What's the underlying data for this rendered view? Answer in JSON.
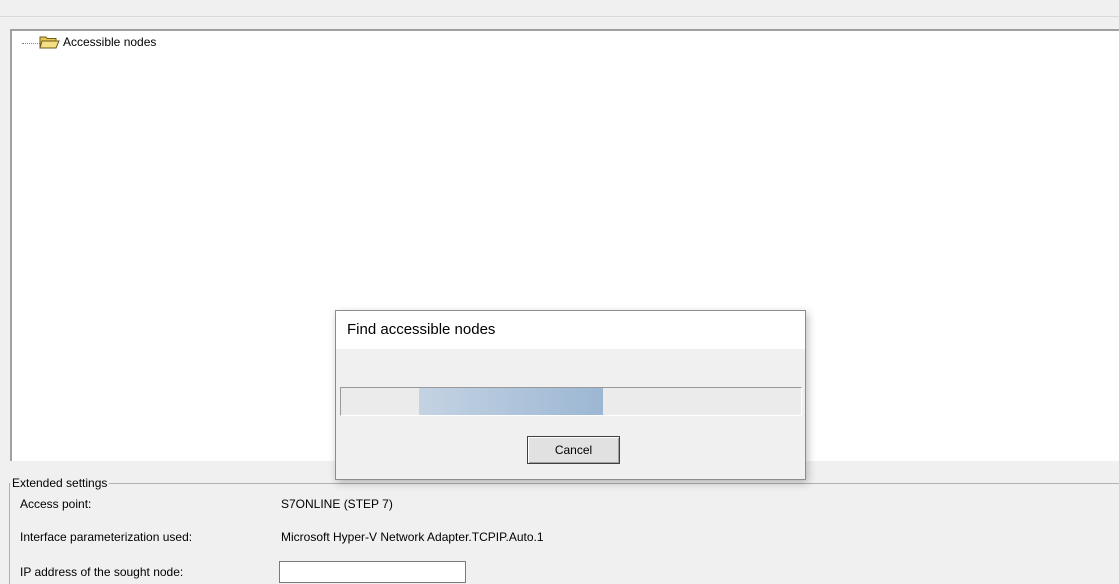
{
  "tree": {
    "root_label": "Accessible nodes",
    "root_icon": "folder-open-icon"
  },
  "extended_settings": {
    "legend": "Extended settings",
    "access_point_label": "Access point:",
    "access_point_value": "S7ONLINE (STEP 7)",
    "interface_label": "Interface parameterization used:",
    "interface_value": "Microsoft Hyper-V Network Adapter.TCPIP.Auto.1",
    "ip_label": "IP address of the sought node:",
    "ip_value": ""
  },
  "dialog": {
    "title": "Find accessible nodes",
    "progress_fraction": 0.4,
    "cancel_label": "Cancel"
  },
  "colors": {
    "progress_start": "#c4d3e3",
    "progress_end": "#9cb7d3",
    "window_bg": "#f0f0f0"
  }
}
